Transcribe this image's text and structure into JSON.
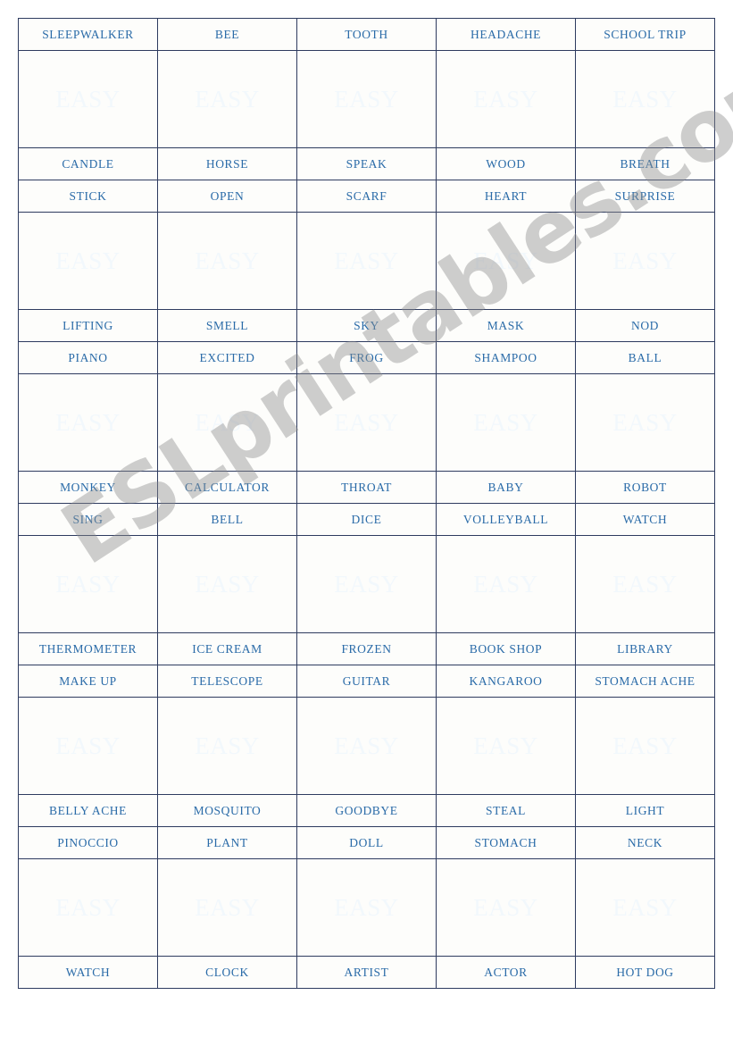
{
  "document": {
    "type": "esl-vocabulary-card-sheet",
    "columns": 5,
    "accent_color": "#0d6cb6",
    "word_text_color": "#2a6ba8",
    "border_color": "#2e3b5f",
    "easy_label": "EASY"
  },
  "watermark": {
    "text": "ESLprintables.com",
    "color": "#8d8d8d",
    "rotation_deg": -33
  },
  "rows": [
    {
      "kind": "words",
      "cells": [
        "SLEEPWALKER",
        "BEE",
        "TOOTH",
        "HEADACHE",
        "SCHOOL TRIP"
      ]
    },
    {
      "kind": "easy",
      "cells": [
        "EASY",
        "EASY",
        "EASY",
        "EASY",
        "EASY"
      ]
    },
    {
      "kind": "words",
      "cells": [
        "CANDLE",
        "HORSE",
        "SPEAK",
        "WOOD",
        "BREATH"
      ]
    },
    {
      "kind": "words",
      "cells": [
        "STICK",
        "OPEN",
        "SCARF",
        "HEART",
        "SURPRISE"
      ]
    },
    {
      "kind": "easy",
      "cells": [
        "EASY",
        "EASY",
        "EASY",
        "EASY",
        "EASY"
      ]
    },
    {
      "kind": "words",
      "cells": [
        "LIFTING",
        "SMELL",
        "SKY",
        "MASK",
        "NOD"
      ]
    },
    {
      "kind": "words",
      "cells": [
        "PIANO",
        "EXCITED",
        "FROG",
        "SHAMPOO",
        "BALL"
      ]
    },
    {
      "kind": "easy",
      "cells": [
        "EASY",
        "EASY",
        "EASY",
        "EASY",
        "EASY"
      ]
    },
    {
      "kind": "words",
      "cells": [
        "MONKEY",
        "CALCULATOR",
        "THROAT",
        "BABY",
        "ROBOT"
      ]
    },
    {
      "kind": "words",
      "cells": [
        "SING",
        "BELL",
        "DICE",
        "VOLLEYBALL",
        "WATCH"
      ]
    },
    {
      "kind": "easy",
      "cells": [
        "EASY",
        "EASY",
        "EASY",
        "EASY",
        "EASY"
      ]
    },
    {
      "kind": "words",
      "cells": [
        "THERMOMETER",
        "ICE CREAM",
        "FROZEN",
        "BOOK SHOP",
        "LIBRARY"
      ]
    },
    {
      "kind": "words",
      "cells": [
        "MAKE UP",
        "TELESCOPE",
        "GUITAR",
        "KANGAROO",
        "STOMACH ACHE"
      ]
    },
    {
      "kind": "easy",
      "cells": [
        "EASY",
        "EASY",
        "EASY",
        "EASY",
        "EASY"
      ]
    },
    {
      "kind": "words",
      "cells": [
        "BELLY ACHE",
        "MOSQUITO",
        "GOODBYE",
        "STEAL",
        "LIGHT"
      ]
    },
    {
      "kind": "words",
      "cells": [
        "PINOCCIO",
        "PLANT",
        "DOLL",
        "STOMACH",
        "NECK"
      ]
    },
    {
      "kind": "easy",
      "cells": [
        "EASY",
        "EASY",
        "EASY",
        "EASY",
        "EASY"
      ]
    },
    {
      "kind": "words",
      "cells": [
        "WATCH",
        "CLOCK",
        "ARTIST",
        "ACTOR",
        "HOT DOG"
      ]
    }
  ]
}
